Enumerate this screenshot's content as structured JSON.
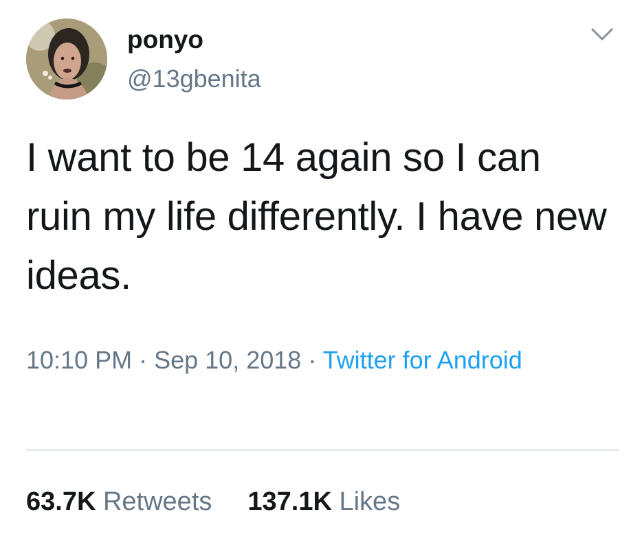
{
  "tweet": {
    "author": {
      "display_name": "ponyo",
      "handle": "@13gbenita"
    },
    "text": "I want to be 14 again so I can ruin my life differently. I have new ideas.",
    "meta": {
      "time": "10:10 PM",
      "separator": " · ",
      "date": "Sep 10, 2018",
      "source": "Twitter for Android"
    },
    "stats": {
      "retweets_count": "63.7K",
      "retweets_label": "Retweets",
      "likes_count": "137.1K",
      "likes_label": "Likes"
    }
  },
  "colors": {
    "text": "#14171a",
    "secondary": "#657786",
    "link": "#1da1f2",
    "divider": "#e6ecf0"
  },
  "icons": {
    "menu": "chevron-down-icon"
  }
}
